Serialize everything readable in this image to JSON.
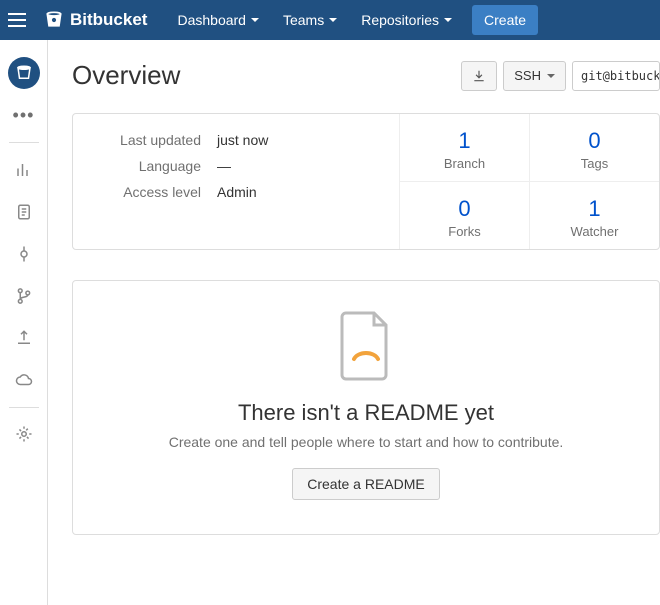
{
  "nav": {
    "brand": "Bitbucket",
    "dashboard": "Dashboard",
    "teams": "Teams",
    "repositories": "Repositories",
    "create": "Create"
  },
  "page": {
    "title": "Overview"
  },
  "clone": {
    "protocol": "SSH",
    "url": "git@bitbuck"
  },
  "meta": {
    "updated_label": "Last updated",
    "updated_value": "just now",
    "language_label": "Language",
    "language_value": "—",
    "access_label": "Access level",
    "access_value": "Admin"
  },
  "stats": {
    "branch_count": "1",
    "branch_label": "Branch",
    "tags_count": "0",
    "tags_label": "Tags",
    "forks_count": "0",
    "forks_label": "Forks",
    "watcher_count": "1",
    "watcher_label": "Watcher"
  },
  "readme": {
    "title": "There isn't a README yet",
    "subtitle": "Create one and tell people where to start and how to contribute.",
    "button": "Create a README"
  }
}
